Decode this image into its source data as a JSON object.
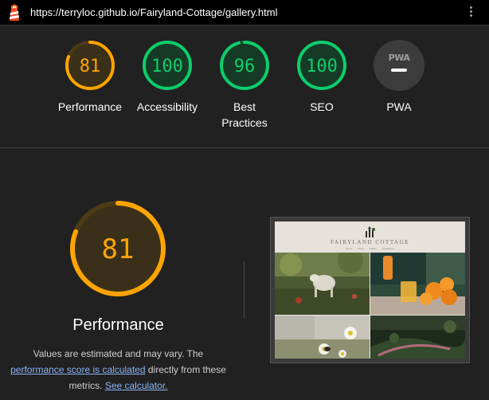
{
  "topbar": {
    "url": "https://terryloc.github.io/Fairyland-Cottage/gallery.html",
    "logo_icon": "lighthouse-icon",
    "menu_icon": "kebab-menu-icon"
  },
  "colors": {
    "average": "#ffa400",
    "pass": "#0cce6b",
    "pwa_gray": "#9e9e9e",
    "link": "#8ab4f8"
  },
  "scores": [
    {
      "value": "81",
      "label": "Performance",
      "score": 0.81,
      "rating": "average"
    },
    {
      "value": "100",
      "label": "Accessibility",
      "score": 1.0,
      "rating": "pass"
    },
    {
      "value": "96",
      "label": "Best Practices",
      "score": 0.96,
      "rating": "pass"
    },
    {
      "value": "100",
      "label": "SEO",
      "score": 1.0,
      "rating": "pass"
    },
    {
      "value": "PWA",
      "label": "PWA",
      "rating": "na"
    }
  ],
  "main": {
    "score": "81",
    "score_fraction": 0.81,
    "title": "Performance",
    "desc_part1": "Values are estimated and may vary. The",
    "desc_link1": "performance score is calculated",
    "desc_part2": "directly from these metrics.",
    "desc_link2": "See calculator."
  },
  "screenshot": {
    "site_title": "FAIRYLAND COTTAGE",
    "nav": [
      "Home",
      "Menu",
      "Gallery",
      "Contact Us"
    ]
  }
}
